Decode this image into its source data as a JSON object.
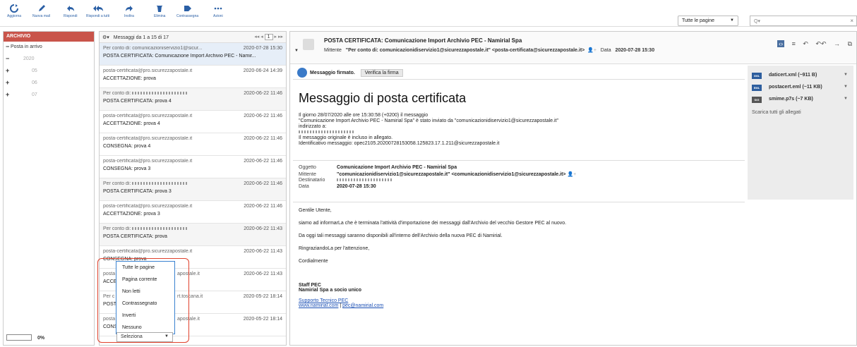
{
  "toolbar": {
    "buttons": [
      {
        "label": "Aggiorna",
        "icon": "refresh-icon"
      },
      {
        "label": "Nuova mail",
        "icon": "pencil-icon"
      },
      {
        "label": "Rispondi",
        "icon": "reply-icon"
      },
      {
        "label": "Rispondi a tutti",
        "icon": "reply-all-icon"
      },
      {
        "label": "Inoltra",
        "icon": "forward-icon"
      },
      {
        "label": "Elimina",
        "icon": "trash-icon"
      },
      {
        "label": "Contrassegna",
        "icon": "tag-icon"
      },
      {
        "label": "Azioni",
        "icon": "more-icon"
      }
    ],
    "page_select": "Tutte le pagine",
    "search_placeholder": "Q▾"
  },
  "folders": {
    "title": "ARCHIVIO",
    "items": [
      {
        "sym": "−",
        "label": "Posta in arrivo"
      },
      {
        "sym": "−",
        "label": "2020"
      },
      {
        "sym": "+",
        "label": "05"
      },
      {
        "sym": "+",
        "label": "06"
      },
      {
        "sym": "+",
        "label": "07"
      }
    ],
    "progress": "0%"
  },
  "list": {
    "header": "Messaggi da 1 a 15 di 17",
    "page": "1",
    "rows": [
      {
        "from": "Per conto di: comunicazioniservizio1@sicur...",
        "date": "2020-07-28 15:30",
        "subject": "POSTA CERTIFICATA: Comunicazione Import Archivio PEC - Namir..."
      },
      {
        "from": "posta-certificata@pro.sicurezzapostale.it",
        "date": "2020-06-24 14:39",
        "subject": "ACCETTAZIONE: prova"
      },
      {
        "from": "Per conto di:",
        "date": "2020-06-22 11:46",
        "subject": "POSTA CERTIFICATA: prova 4"
      },
      {
        "from": "posta-certificata@pro.sicurezzapostale.it",
        "date": "2020-06-22 11:46",
        "subject": "ACCETTAZIONE: prova 4"
      },
      {
        "from": "posta-certificata@pro.sicurezzapostale.it",
        "date": "2020-06-22 11:46",
        "subject": "CONSEGNA: prova 4"
      },
      {
        "from": "posta-certificata@pro.sicurezzapostale.it",
        "date": "2020-06-22 11:46",
        "subject": "CONSEGNA: prova 3"
      },
      {
        "from": "Per conto di:",
        "date": "2020-06-22 11:46",
        "subject": "POSTA CERTIFICATA: prova 3"
      },
      {
        "from": "posta-certificata@pro.sicurezzapostale.it",
        "date": "2020-06-22 11:46",
        "subject": "ACCETTAZIONE: prova 3"
      },
      {
        "from": "Per conto di:",
        "date": "2020-06-22 11:43",
        "subject": "POSTA CERTIFICATA: prova"
      },
      {
        "from": "posta-certificata@pro.sicurezzapostale.it",
        "date": "2020-06-22 11:43",
        "subject": "CONSEGNA: prova"
      },
      {
        "from": "posta",
        "date": "2020-06-22 11:43",
        "subject": "ACCE"
      },
      {
        "from": "Per c",
        "date": "2020-05-22 18:14",
        "subject": "POST"
      },
      {
        "from": "posta",
        "date": "2020-05-22 18:14",
        "subject": "CONS"
      }
    ],
    "row_tails": [
      "apostale.it",
      "rt.toscana.it",
      "apostale.it"
    ],
    "dropdown": [
      "Tutte le pagine",
      "Pagina corrente",
      "Non letti",
      "Contrassegnato",
      "Inverti",
      "Nessuno"
    ],
    "select_label": "Seleziona"
  },
  "reader": {
    "subject": "POSTA CERTIFICATA: Comunicazione Import Archivio PEC - Namirial Spa",
    "sender_label": "Mittente",
    "sender": "\"Per conto di: comunicazionidiservizio1@sicurezzapostale.it\" <posta-certificata@sicurezzapostale.it>",
    "date_label": "Data",
    "date": "2020-07-28 15:30",
    "signed": "Messaggio firmato.",
    "verify": "Verifica la firma",
    "title": "Messaggio di posta certificata",
    "para": [
      "Il giorno 28/07/2020 alle ore 15:30:58 (+0200) il messaggio",
      "\"Comunicazione Import Archivio PEC - Namirial Spa\" è stato inviato da \"comunicazionidiservizio1@sicurezzapostale.it\"",
      "indirizzato a:",
      "Il messaggio originale è incluso in allegato.",
      "Identificativo messaggio: opec2105.20200728153058.125823.17.1.211@sicurezzapostale.it"
    ],
    "details": [
      {
        "k": "Oggetto",
        "v": "Comunicazione Import Archivio PEC - Namirial Spa"
      },
      {
        "k": "Mittente",
        "v": "\"comunicazionidiservizio1@sicurezzapostale.it\" <comunicazionidiservizio1@sicurezzapostale.it>"
      },
      {
        "k": "Destinatario",
        "v": ""
      },
      {
        "k": "Data",
        "v": "2020-07-28 15:30"
      }
    ],
    "body": [
      "Gentile Utente,",
      "siamo ad informarLa che è terminata l'attività d'importazione dei messaggi dall'Archivio del vecchio Gestore PEC al nuovo.",
      "Da oggi tali messaggi saranno disponibili all'interno dell'Archivio della nuova PEC di Namirial.",
      "RingraziandoLa per l'attenzione,",
      "Cordialmente"
    ],
    "sig1": "Staff PEC",
    "sig2": "Namirial Spa a socio unico",
    "link1": "Supporto Tecnico PEC",
    "link2": "www.namirial.com",
    "sep": "|",
    "link3": "pec@namirial.com",
    "attachments": [
      {
        "icon": "XML",
        "name": "daticert.xml (~911 B)"
      },
      {
        "icon": "EML",
        "name": "postacert.eml (~11 KB)"
      },
      {
        "icon": "SIG",
        "name": "smime.p7s (~7 KB)"
      }
    ],
    "download_all": "Scarica tutti gli allegati"
  }
}
